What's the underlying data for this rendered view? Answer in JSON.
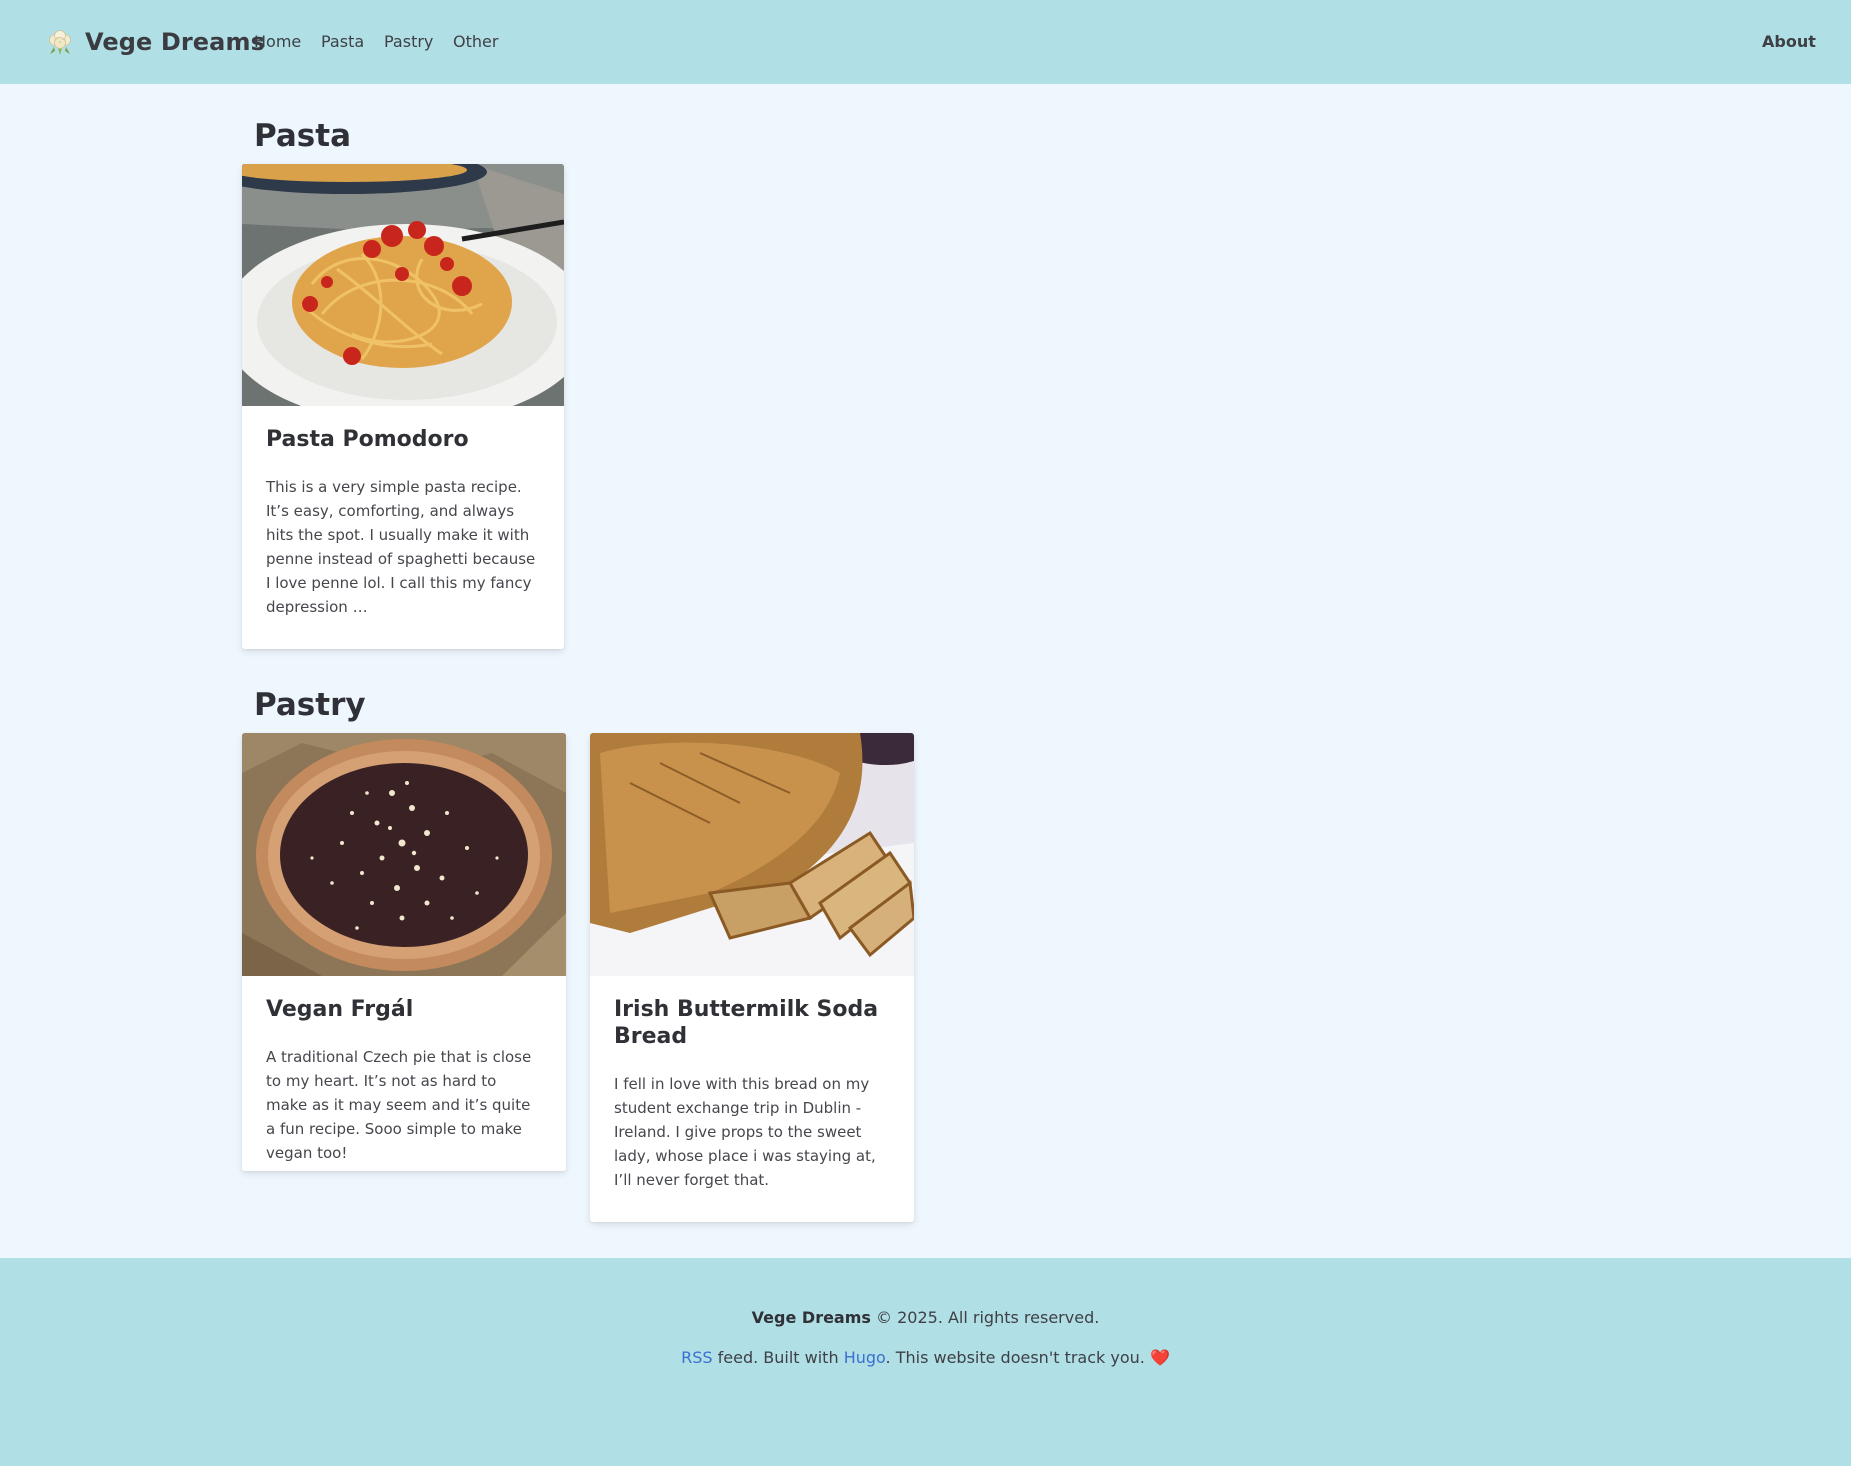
{
  "header": {
    "brand": "Vege Dreams",
    "nav": [
      "Home",
      "Pasta",
      "Pastry",
      "Other"
    ],
    "about": "About"
  },
  "sections": [
    {
      "title": "Pasta",
      "cards": [
        {
          "title": "Pasta Pomodoro",
          "summary": "This is a very simple pasta recipe. It’s easy, comforting, and always hits the spot. I usually make it with penne instead of spaghetti because I love penne lol. I call this my fancy depression …"
        }
      ]
    },
    {
      "title": "Pastry",
      "cards": [
        {
          "title": "Vegan Frgál",
          "summary": "A traditional Czech pie that is close to my heart. It’s not as hard to make as it may seem and it’s quite a fun recipe. Sooo simple to make vegan too!"
        },
        {
          "title": "Irish Buttermilk Soda Bread",
          "summary": "I fell in love with this bread on my student exchange trip in Dublin - Ireland. I give props to the sweet lady, whose place i was staying at, I’ll never forget that."
        }
      ]
    }
  ],
  "footer": {
    "brand": "Vege Dreams",
    "copyright": " © 2025. All rights reserved.",
    "rss_link": "RSS",
    "feed_text": " feed. Built with ",
    "hugo_link": "Hugo",
    "tracking_text": ". This website doesn't track you. ",
    "heart": "❤️"
  },
  "colors": {
    "header_bg": "#b0dfe5",
    "page_bg": "#eff7fe",
    "link": "#3b6fd0"
  },
  "icons": [
    "cauliflower-logo-icon",
    "heart-icon"
  ]
}
